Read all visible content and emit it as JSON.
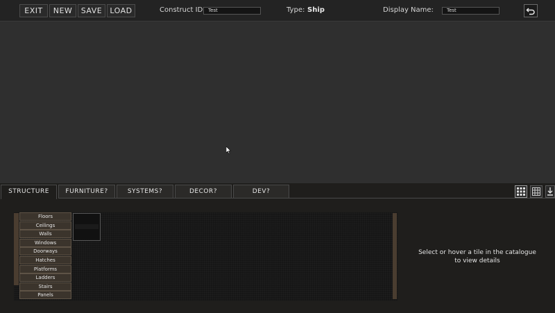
{
  "topbar": {
    "buttons": {
      "exit": "EXIT",
      "new": "NEW",
      "save": "SAVE",
      "load": "LOAD"
    },
    "construct_id_label": "Construct ID:",
    "construct_id_value": "Test",
    "type_label": "Type:",
    "type_value": "Ship",
    "display_name_label": "Display Name:",
    "display_name_value": "Test",
    "undo_icon": "undo-arrow-icon"
  },
  "tabs": [
    {
      "label": "STRUCTURE",
      "active": true
    },
    {
      "label": "FURNITURE?"
    },
    {
      "label": "SYSTEMS?"
    },
    {
      "label": "DECOR?"
    },
    {
      "label": "DEV?"
    }
  ],
  "view_buttons": [
    "grid-small-icon",
    "grid-large-icon",
    "export-icon"
  ],
  "categories": [
    "Floors",
    "Ceilings",
    "Walls",
    "Windows",
    "Doorways",
    "Hatches",
    "Platforms",
    "Ladders",
    "Stairs",
    "Panels"
  ],
  "details_text": "Select or hover a tile in the catalogue to view details",
  "colors": {
    "background": "#2f2f2f",
    "topbar": "#232323",
    "panel": "#1f1e1c",
    "category_button": "#3b342c",
    "scrollbar": "#4a3d30"
  }
}
